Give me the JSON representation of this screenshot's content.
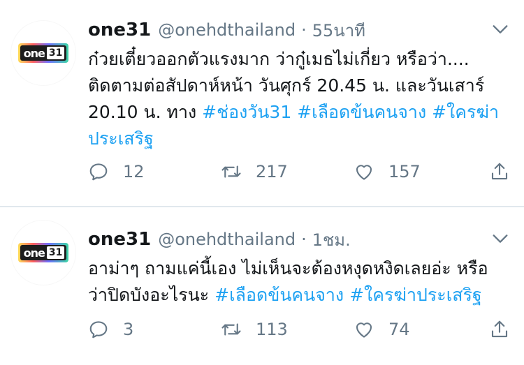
{
  "tweets": [
    {
      "logo_text": "one",
      "logo_box": "31",
      "name": "one31",
      "handle": "@onehdthailand",
      "separator": "·",
      "time": "55นาที",
      "text_plain": "ก๋วยเตี๋ยวออกตัวแรงมาก ว่ากู๋เมธไม่เกี่ยว หรือว่า.... ติดตามต่อสัปดาห์หน้า วันศุกร์ 20.45 น. และวันเสาร์ 20.10 น. ทาง ",
      "hashtags": [
        "#ช่องวัน31",
        "#เลือดข้นคนจาง",
        "#ใครฆ่าประเสริฐ"
      ],
      "replies": "12",
      "retweets": "217",
      "likes": "157"
    },
    {
      "logo_text": "one",
      "logo_box": "31",
      "name": "one31",
      "handle": "@onehdthailand",
      "separator": "·",
      "time": "1ชม.",
      "text_plain": "อาม่าๆ ถามแค่นี้เอง ไม่เห็นจะต้องหงุดหงิดเลยอ่ะ หรือว่าปิดบังอะไรนะ ",
      "hashtags": [
        "#เลือดข้นคนจาง",
        "#ใครฆ่าประเสริฐ"
      ],
      "replies": "3",
      "retweets": "113",
      "likes": "74"
    }
  ],
  "icons": {
    "reply": "reply-icon",
    "retweet": "retweet-icon",
    "like": "like-icon",
    "share": "share-icon",
    "more": "chevron-down-icon"
  },
  "colors": {
    "text": "#14171a",
    "secondary": "#657786",
    "hashtag": "#1da1f2",
    "divider": "#e1e8ed"
  }
}
